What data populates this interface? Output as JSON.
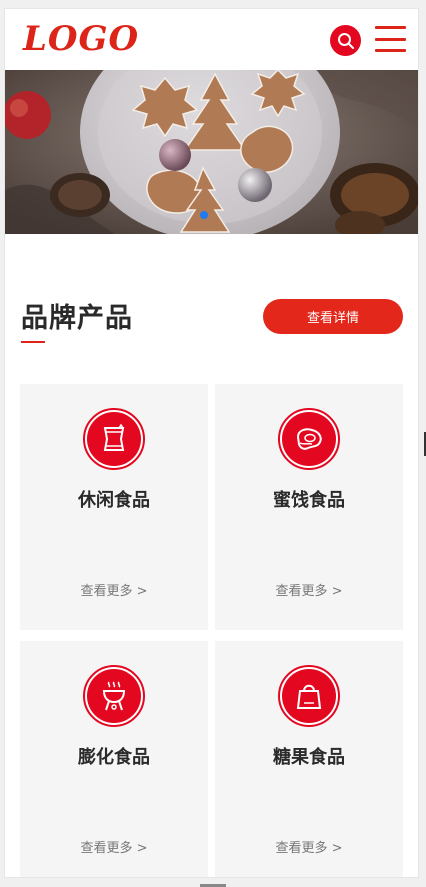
{
  "header": {
    "logo_text": "LOGO",
    "search_icon": "search-icon",
    "menu_icon": "hamburger-menu-icon"
  },
  "banner": {
    "image": "christmas cookies on plate with pine cones",
    "active_slide": 1
  },
  "section": {
    "title": "品牌产品",
    "detail_button": "查看详情"
  },
  "products": [
    {
      "title": "休闲食品",
      "more": "查看更多 >",
      "icon": "snack-bag-icon"
    },
    {
      "title": "蜜饯食品",
      "more": "查看更多 >",
      "icon": "meat-steak-icon"
    },
    {
      "title": "膨化食品",
      "more": "查看更多 >",
      "icon": "grill-icon"
    },
    {
      "title": "糖果食品",
      "more": "查看更多 >",
      "icon": "shopping-bag-icon"
    }
  ],
  "colors": {
    "brand_red": "#e3071f",
    "logo_red": "#dc2418",
    "card_bg": "#f5f5f5",
    "pagination_active": "#1e7cf0"
  }
}
